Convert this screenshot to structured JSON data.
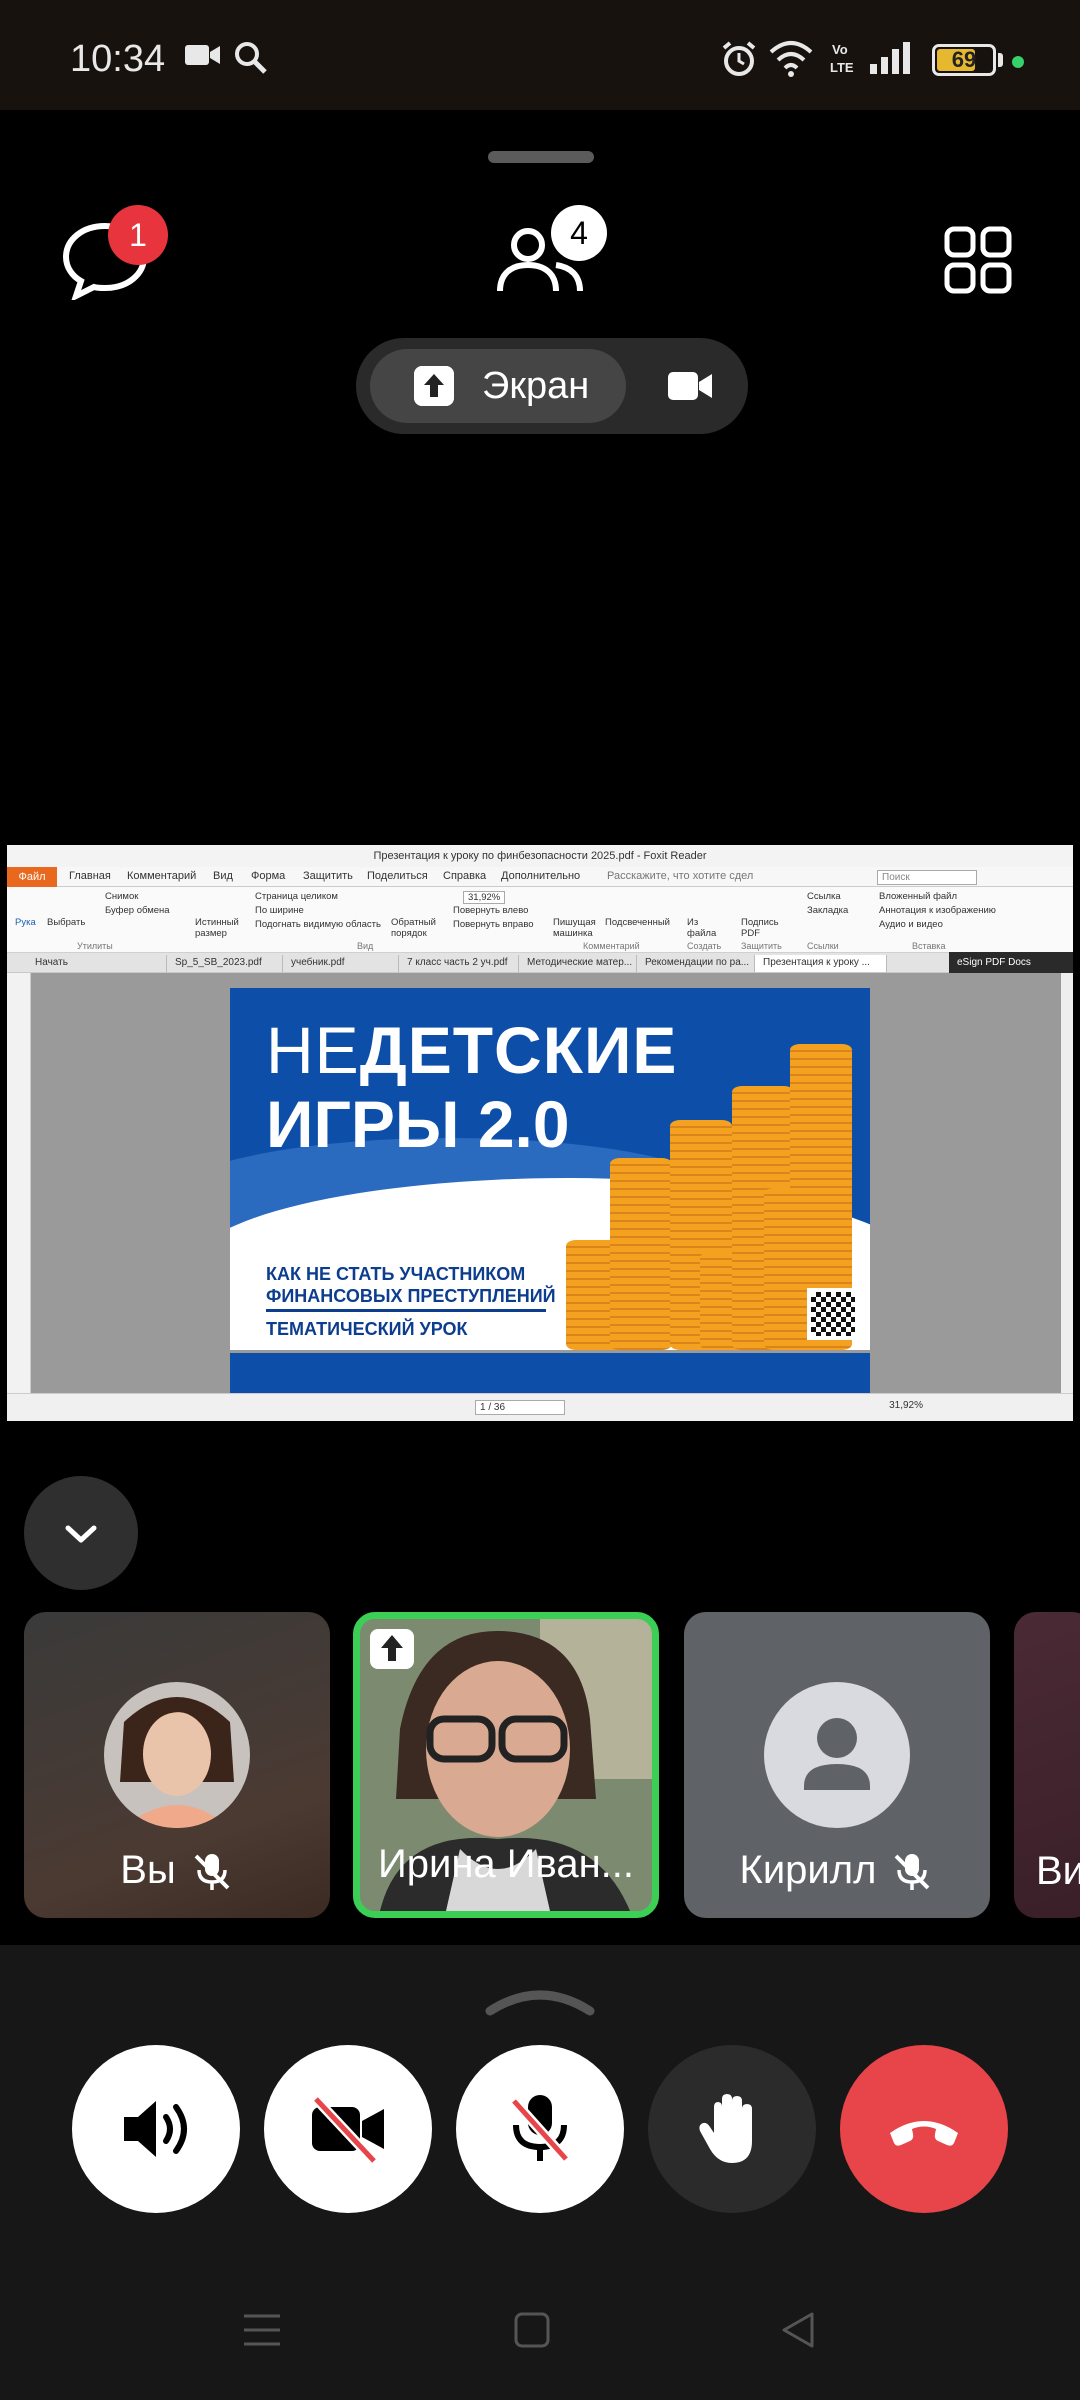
{
  "status_bar": {
    "time": "10:34",
    "battery_level": "69",
    "network_label": "Vo LTE"
  },
  "top_bar": {
    "chat_unread": "1",
    "participants_count": "4",
    "share_label": "Экран"
  },
  "shared_screen": {
    "window_title": "Презентация к уроку по финбезопасности 2025.pdf - Foxit Reader",
    "menu": [
      "Файл",
      "Главная",
      "Комментарий",
      "Вид",
      "Форма",
      "Защитить",
      "Поделиться",
      "Справка",
      "Дополнительно"
    ],
    "tell_me": "Расскажите, что хотите сдел",
    "search_placeholder": "Поиск",
    "ribbon": {
      "hand": "Рука",
      "select": "Выбрать",
      "snapshot": "Снимок",
      "clipboard": "Буфер обмена",
      "actual_size": "Истинный размер",
      "full_page": "Страница целиком",
      "fit_width": "По ширине",
      "fit_visible": "Подогнать видимую область",
      "reverse": "Обратный порядок",
      "zoom": "31,92%",
      "rotate_left": "Повернуть влево",
      "rotate_right": "Повернуть вправо",
      "typewriter": "Пишущая машинка",
      "highlight": "Подсвеченный",
      "from_file": "Из файла",
      "sign_pdf": "Подпись PDF",
      "link": "Ссылка",
      "bookmark": "Закладка",
      "attached_file": "Вложенный файл",
      "image_annotation": "Аннотация к изображению",
      "audio_video": "Аудио и видео",
      "groups": [
        "Утилиты",
        "Вид",
        "Комментарий",
        "Создать",
        "Защитить",
        "Ссылки",
        "Вставка"
      ]
    },
    "tabs": [
      "Начать",
      "Sp_5_SB_2023.pdf",
      "учебник.pdf",
      "7 класс часть 2 уч.pdf",
      "Методические матер...",
      "Рекомендации по ра...",
      "Презентация к уроку ..."
    ],
    "esign": "eSign PDF Docs",
    "page_indicator": "1 / 36",
    "status_zoom": "31,92%",
    "slide": {
      "title_thin": "НЕ",
      "title_bold": "ДЕТСКИЕ",
      "title_line2": "ИГРЫ 2.0",
      "subtitle": "КАК НЕ СТАТЬ УЧАСТНИКОМ ФИНАНСОВЫХ ПРЕСТУПЛЕНИЙ",
      "lesson": "ТЕМАТИЧЕСКИЙ УРОК"
    }
  },
  "participants": [
    {
      "name": "Вы",
      "muted": true
    },
    {
      "name": "Ирина Иван...",
      "sharing": true
    },
    {
      "name": "Кирилл",
      "muted": true
    },
    {
      "name": "Ви"
    }
  ],
  "colors": {
    "end_call": "#e8454a",
    "active_speaker": "#3ccf56",
    "badge": "#e8353d"
  }
}
